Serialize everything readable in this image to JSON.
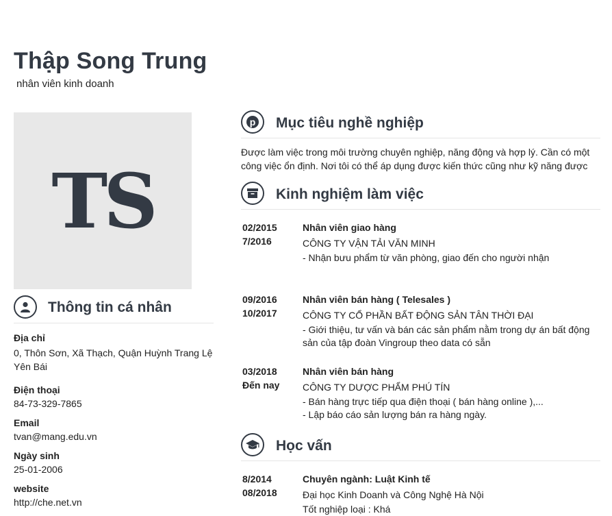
{
  "header": {
    "name": "Thập Song Trung",
    "job_title": "nhân viên kinh doanh",
    "avatar_initials": "TS"
  },
  "personal": {
    "title": "Thông tin cá nhân",
    "address_label": "Địa chỉ",
    "address_line1": "0, Thôn Sơn, Xã Thạch, Quận Huỳnh Trang Lệ",
    "address_line2": "Yên Bái",
    "phone_label": "Điện thoại",
    "phone": "84-73-329-7865",
    "email_label": "Email",
    "email": "tvan@mang.edu.vn",
    "dob_label": "Ngày sinh",
    "dob": "25-01-2006",
    "website_label": "website",
    "website": "http://che.net.vn"
  },
  "objective": {
    "title": "Mục tiêu nghề nghiệp",
    "line1": "Được làm việc trong môi trường chuyên nghiệp, năng động và hợp lý. Cần có một",
    "line2": "công việc ổn định. Nơi tôi có thể áp dụng được kiến thức cũng như kỹ năng được"
  },
  "experience": {
    "title": "Kinh nghiệm làm việc",
    "items": [
      {
        "start": "02/2015",
        "end": "7/2016",
        "position": "Nhân viên giao hàng",
        "company": "CÔNG TY VẬN TẢI VĂN MINH",
        "desc1": "- Nhận bưu phẩm từ văn phòng, giao đến cho người nhận",
        "desc2": ""
      },
      {
        "start": "09/2016",
        "end": "10/2017",
        "position": "Nhân viên bán hàng ( Telesales )",
        "company": "CÔNG TY CỔ PHẦN BẤT ĐỘNG SẢN TÂN THỜI ĐẠI",
        "desc1": "- Giới thiệu, tư vấn và bán các sản phẩm nằm trong dự án bất động",
        "desc2": "sản của tập đoàn Vingroup theo data có sẵn"
      },
      {
        "start": "03/2018",
        "end": "Đến nay",
        "position": "Nhân viên bán hàng",
        "company": "CÔNG TY DƯỢC PHẨM PHÚ TÍN",
        "desc1": "- Bán hàng trực tiếp qua điện thoại ( bán hàng online ),...",
        "desc2": "- Lập báo cáo sản lượng bán ra hàng ngày."
      }
    ]
  },
  "education": {
    "title": "Học vấn",
    "start": "8/2014",
    "end": "08/2018",
    "major": "Chuyên ngành: Luật Kinh tế",
    "school": "Đại học Kinh Doanh và Công Nghệ Hà Nội",
    "grade": "Tốt nghiệp loại : Khá"
  }
}
